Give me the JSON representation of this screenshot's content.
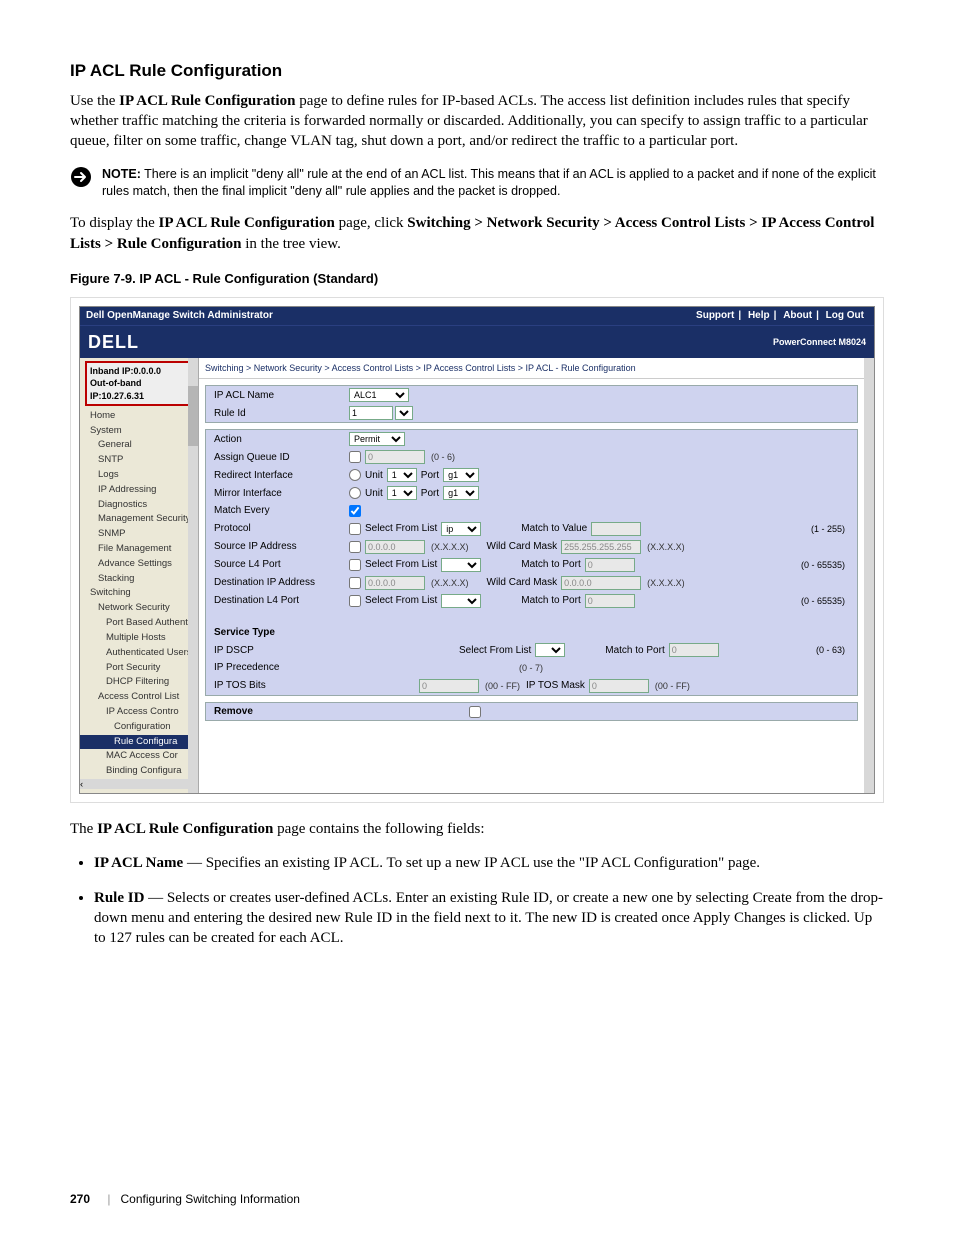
{
  "heading": "IP ACL Rule Configuration",
  "para1_a": "Use the ",
  "para1_b": "IP ACL Rule Configuration",
  "para1_c": " page to define rules for IP-based ACLs. The access list definition includes rules that specify whether traffic matching the criteria is forwarded normally or discarded. Additionally, you can specify to assign traffic to a particular queue, filter on some traffic, change VLAN tag, shut down a port, and/or redirect the traffic to a particular port.",
  "note_label": "NOTE:",
  "note_text": " There is an implicit \"deny all\" rule at the end of an ACL list. This means that if an ACL is applied to a packet and if none of the explicit rules match, then the final implicit \"deny all\" rule applies and the packet is dropped.",
  "para2_a": "To display the ",
  "para2_b": "IP ACL Rule Configuration",
  "para2_c": " page, click ",
  "para2_d": "Switching > Network Security > Access Control Lists > IP Access Control Lists > Rule Configuration",
  "para2_e": " in the tree view.",
  "fig_caption": "Figure 7-9.    IP ACL - Rule Configuration (Standard)",
  "app": {
    "title": "Dell OpenManage Switch Administrator",
    "links": {
      "support": "Support",
      "help": "Help",
      "about": "About",
      "logout": "Log Out"
    },
    "brand": "DELL",
    "product": "PowerConnect M8024",
    "ip_inband": "Inband IP:0.0.0.0",
    "ip_oob": "Out-of-band IP:10.27.6.31",
    "crumbs": [
      "Switching",
      "Network Security",
      "Access Control Lists",
      "IP Access Control Lists",
      "IP ACL - Rule Configuration"
    ],
    "tree": [
      {
        "t": "Home",
        "c": ""
      },
      {
        "t": "System",
        "c": ""
      },
      {
        "t": "General",
        "c": "sub1"
      },
      {
        "t": "SNTP",
        "c": "sub1"
      },
      {
        "t": "Logs",
        "c": "sub1"
      },
      {
        "t": "IP Addressing",
        "c": "sub1"
      },
      {
        "t": "Diagnostics",
        "c": "sub1"
      },
      {
        "t": "Management Security",
        "c": "sub1"
      },
      {
        "t": "SNMP",
        "c": "sub1"
      },
      {
        "t": "File Management",
        "c": "sub1"
      },
      {
        "t": "Advance Settings",
        "c": "sub1"
      },
      {
        "t": "Stacking",
        "c": "sub1"
      },
      {
        "t": "Switching",
        "c": ""
      },
      {
        "t": "Network Security",
        "c": "sub1"
      },
      {
        "t": "Port Based Authent",
        "c": "sub2"
      },
      {
        "t": "Multiple Hosts",
        "c": "sub2"
      },
      {
        "t": "Authenticated Users",
        "c": "sub2"
      },
      {
        "t": "Port Security",
        "c": "sub2"
      },
      {
        "t": "DHCP Filtering",
        "c": "sub2"
      },
      {
        "t": "Access Control List",
        "c": "sub1"
      },
      {
        "t": "IP Access Contro",
        "c": "sub2"
      },
      {
        "t": "Configuration",
        "c": "sub3"
      },
      {
        "t": "Rule Configura",
        "c": "sub3 sel"
      },
      {
        "t": "MAC Access Cor",
        "c": "sub2"
      },
      {
        "t": "Binding Configura",
        "c": "sub2"
      }
    ],
    "form": {
      "ip_acl_name_label": "IP ACL Name",
      "ip_acl_name_value": "ALC1",
      "rule_id_label": "Rule Id",
      "rule_id_value": "1",
      "action_label": "Action",
      "action_value": "Permit",
      "assign_q_label": "Assign Queue ID",
      "assign_q_value": "0",
      "assign_q_hint": "(0 - 6)",
      "redir_label": "Redirect Interface",
      "unit": "Unit",
      "port": "Port",
      "unit_v": "1",
      "port_v": "g1",
      "mirror_label": "Mirror Interface",
      "match_every_label": "Match Every",
      "proto_label": "Protocol",
      "sel_list": "Select From List",
      "proto_v": "ip",
      "mtv": "Match to Value",
      "proto_hint": "(1 - 255)",
      "srcip_label": "Source IP Address",
      "srcip_v": "0.0.0.0",
      "xxxx": "(X.X.X.X)",
      "wcm": "Wild Card Mask",
      "wcm_v": "255.255.255.255",
      "srcport_label": "Source L4 Port",
      "mtp": "Match to Port",
      "port0": "0",
      "port_hint": "(0 - 65535)",
      "dstip_label": "Destination IP Address",
      "dstip_v": "0.0.0.0",
      "dwcm_v": "0.0.0.0",
      "dstport_label": "Destination L4 Port",
      "svc_title": "Service Type",
      "dscp_label": "IP DSCP",
      "dscp_hint": "(0 - 63)",
      "prec_label": "IP Precedence",
      "prec_hint": "(0 - 7)",
      "tos_label": "IP TOS Bits",
      "tos_v": "0",
      "tos_hint": "(00 - FF)",
      "tos_mask": "IP TOS Mask",
      "tos_mask_v": "0",
      "tos_mask_hint": "(00 - FF)",
      "remove_label": "Remove"
    }
  },
  "post_a": "The ",
  "post_b": "IP ACL Rule Configuration",
  "post_c": " page contains the following fields:",
  "field1_a": "IP ACL Name",
  "field1_b": " — Specifies an existing IP ACL. To set up a new IP ACL use the \"IP ACL Configuration\" page.",
  "field2_a": "Rule ID",
  "field2_b": " — Selects or creates user-defined ACLs. Enter an existing Rule ID, or create a new one by selecting Create from the drop-down menu and entering the desired new Rule ID in the field next to it. The new ID is created once Apply Changes is clicked. Up to 127 rules can be created for each ACL.",
  "footer_page": "270",
  "footer_text": "Configuring Switching Information"
}
